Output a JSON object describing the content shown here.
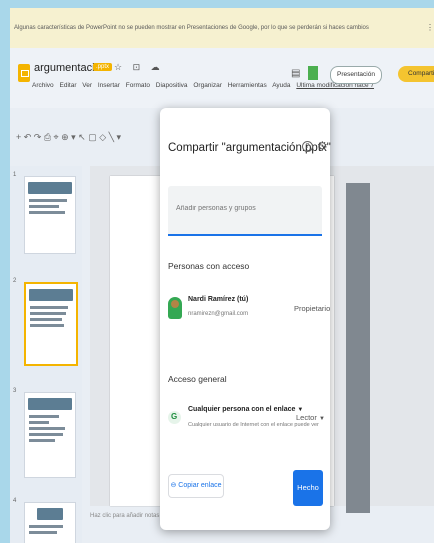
{
  "banner": {
    "text": "Algunas características de PowerPoint no se pueden mostrar en Presentaciones de Google, por lo que se perderán si haces cambios",
    "more": "⋮"
  },
  "app": {
    "doc_name": "argumentación",
    "ext_badge": ".pptx",
    "title_icons": "☆ ⊡ ☁",
    "menu": [
      "Archivo",
      "Editar",
      "Ver",
      "Insertar",
      "Formato",
      "Diapositiva",
      "Organizar",
      "Herramientas",
      "Ayuda",
      "Ultima modificación hace 7"
    ],
    "present_label": "Presentación",
    "share_label": "Compartir"
  },
  "toolbar": {
    "left": "+ ↶ ↷ ⎙ ⌖ ⊕ ▾ ↖ ▢ ◇ ╲ ▾"
  },
  "dialog": {
    "title": "Compartir \"argumentación.pptx\"",
    "help": "?",
    "settings": "⚙",
    "add_placeholder": "Añadir personas y grupos",
    "people_heading": "Personas con acceso",
    "person": {
      "name": "Nardi Ramírez (tú)",
      "email": "nramirezn@gmail.com",
      "role": "Propietario"
    },
    "general_heading": "Acceso general",
    "general": {
      "label": "Cualquier persona con el enlace",
      "description": "Cualquier usuario de Internet con el enlace puede ver",
      "role": "Lector"
    },
    "copy_link": "⊖ Copiar enlace",
    "done": "Hecho"
  },
  "thumbs": [
    {
      "num": "1",
      "heading": "argumentación",
      "lines": [
        "Argumentar es dar razones o argumentos",
        "en favor o en contra de una postura"
      ]
    },
    {
      "num": "2",
      "heading": "la argumentación",
      "lines": [
        "Tipo de texto en el que",
        "se defiende una idea",
        "para convencer al lector"
      ]
    },
    {
      "num": "3",
      "heading": "estructura del texto argumentativo",
      "lines": [
        "Tesis",
        "Argumentos",
        "Conclusión"
      ]
    },
    {
      "num": "4",
      "heading": "tesis",
      "lines": [
        "Idea que se defiende"
      ]
    }
  ],
  "notes": "Haz clic para añadir notas del orador"
}
